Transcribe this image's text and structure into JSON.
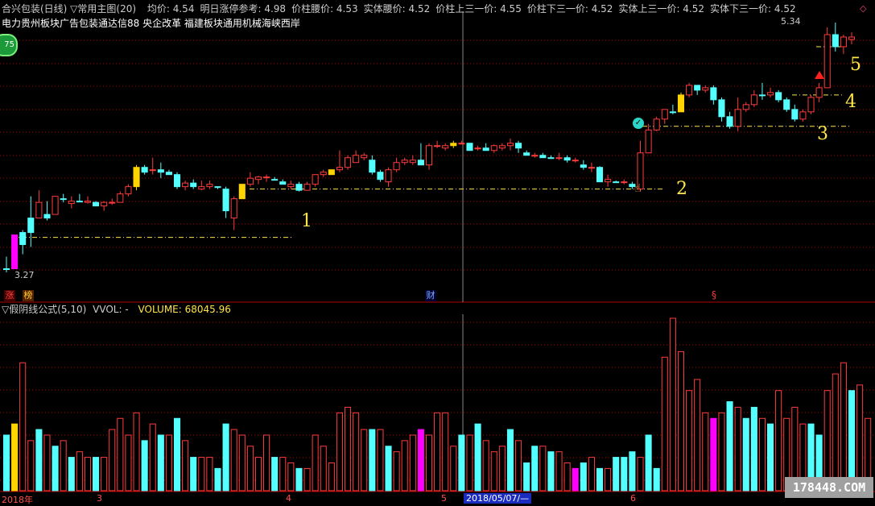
{
  "header": {
    "title": "合兴包装(日线) ▽常用主图(20)",
    "stats": [
      {
        "label": "均价",
        "value": "4.54"
      },
      {
        "label": "明日涨停参考",
        "value": "4.98"
      },
      {
        "label": "价柱腰价",
        "value": "4.53"
      },
      {
        "label": "实体腰价",
        "value": "4.52"
      },
      {
        "label": "价柱上三一价",
        "value": "4.55"
      },
      {
        "label": "价柱下三一价",
        "value": "4.52"
      },
      {
        "label": "实体上三一价",
        "value": "4.52"
      },
      {
        "label": "实体下三一价",
        "value": "4.52"
      }
    ],
    "sectors": "电力贵州板块广告包装通达信88 央企改革 福建板块通用机械海峡西岸",
    "badge": "75"
  },
  "price_labels": {
    "high": "5.34",
    "low": "3.27"
  },
  "markers": {
    "zhang": "涨",
    "bang": "榜",
    "cai": "财",
    "s": "§"
  },
  "annotations": [
    "1",
    "2",
    "3",
    "4",
    "5"
  ],
  "volume_header": {
    "title": "▽假阴线公式(5,10)",
    "vvol": "VVOL: -",
    "volume_label": "VOLUME:",
    "volume_value": "68045.96"
  },
  "x_axis": {
    "labels": [
      "2018年",
      "3",
      "4",
      "5",
      "2018/05/07/—",
      "6"
    ]
  },
  "watermark": "178448.COM",
  "colors": {
    "up": "#ff3c3c",
    "down": "#54ffff",
    "special": "#ff00ff",
    "limit": "#ffd400",
    "grid": "#b00000",
    "text": "#cccccc",
    "mark": "#ffe44a"
  },
  "chart_data": {
    "type": "candlestick",
    "price_range": [
      3.27,
      5.34
    ],
    "candles": [
      [
        3.3,
        3.4,
        3.27,
        3.3,
        "d"
      ],
      [
        3.3,
        3.58,
        3.3,
        3.58,
        "s"
      ],
      [
        3.6,
        3.62,
        3.42,
        3.5,
        "d"
      ],
      [
        3.6,
        3.9,
        3.48,
        3.72,
        "d"
      ],
      [
        3.72,
        3.95,
        3.72,
        3.85,
        "u"
      ],
      [
        3.72,
        3.86,
        3.7,
        3.75,
        "d"
      ],
      [
        3.75,
        3.88,
        3.75,
        3.9,
        "u"
      ],
      [
        3.88,
        3.92,
        3.85,
        3.88,
        "d"
      ],
      [
        3.84,
        3.9,
        3.8,
        3.86,
        "u"
      ],
      [
        3.86,
        3.92,
        3.86,
        3.86,
        "d"
      ],
      [
        3.86,
        3.9,
        3.84,
        3.85,
        "u"
      ],
      [
        3.85,
        3.86,
        3.82,
        3.82,
        "d"
      ],
      [
        3.82,
        3.86,
        3.78,
        3.85,
        "u"
      ],
      [
        3.85,
        3.88,
        3.83,
        3.85,
        "u"
      ],
      [
        3.85,
        3.94,
        3.85,
        3.92,
        "u"
      ],
      [
        3.92,
        4.0,
        3.9,
        3.98,
        "u"
      ],
      [
        3.98,
        4.16,
        3.95,
        4.14,
        "l"
      ],
      [
        4.14,
        4.16,
        4.08,
        4.1,
        "d"
      ],
      [
        4.12,
        4.22,
        4.08,
        4.12,
        "u"
      ],
      [
        4.12,
        4.18,
        4.05,
        4.1,
        "d"
      ],
      [
        4.1,
        4.12,
        4.08,
        4.08,
        "d"
      ],
      [
        4.08,
        4.1,
        3.96,
        3.98,
        "d"
      ],
      [
        3.98,
        4.03,
        3.95,
        4.01,
        "u"
      ],
      [
        4.01,
        4.04,
        3.96,
        3.98,
        "d"
      ],
      [
        3.96,
        4.03,
        3.95,
        3.98,
        "u"
      ],
      [
        3.98,
        4.03,
        3.96,
        4.0,
        "u"
      ],
      [
        3.98,
        3.98,
        3.96,
        3.98,
        "d"
      ],
      [
        3.96,
        3.98,
        3.72,
        3.78,
        "d"
      ],
      [
        3.72,
        3.9,
        3.62,
        3.88,
        "u"
      ],
      [
        3.88,
        4.0,
        3.88,
        4.0,
        "l"
      ],
      [
        4.0,
        4.1,
        3.98,
        4.05,
        "u"
      ],
      [
        4.04,
        4.07,
        4.0,
        4.06,
        "u"
      ],
      [
        4.06,
        4.08,
        4.02,
        4.06,
        "u"
      ],
      [
        4.04,
        4.06,
        4.04,
        4.04,
        "d"
      ],
      [
        4.02,
        4.04,
        4.0,
        4.0,
        "d"
      ],
      [
        3.98,
        4.03,
        3.96,
        4.0,
        "u"
      ],
      [
        4.0,
        4.02,
        3.94,
        3.95,
        "d"
      ],
      [
        3.95,
        4.02,
        3.95,
        4.0,
        "u"
      ],
      [
        4.0,
        4.08,
        3.98,
        4.08,
        "u"
      ],
      [
        4.08,
        4.12,
        4.06,
        4.1,
        "u"
      ],
      [
        4.08,
        4.12,
        4.08,
        4.12,
        "l"
      ],
      [
        4.12,
        4.28,
        4.1,
        4.14,
        "u"
      ],
      [
        4.14,
        4.24,
        4.12,
        4.22,
        "u"
      ],
      [
        4.18,
        4.28,
        4.18,
        4.24,
        "u"
      ],
      [
        4.22,
        4.26,
        4.2,
        4.24,
        "u"
      ],
      [
        4.2,
        4.24,
        4.08,
        4.1,
        "d"
      ],
      [
        4.1,
        4.12,
        4.02,
        4.04,
        "d"
      ],
      [
        4.02,
        4.14,
        3.98,
        4.12,
        "u"
      ],
      [
        4.12,
        4.22,
        4.1,
        4.18,
        "u"
      ],
      [
        4.18,
        4.22,
        4.16,
        4.2,
        "u"
      ],
      [
        4.18,
        4.24,
        4.16,
        4.2,
        "u"
      ],
      [
        4.2,
        4.34,
        4.18,
        4.16,
        "d"
      ],
      [
        4.16,
        4.34,
        4.12,
        4.32,
        "u"
      ],
      [
        4.32,
        4.36,
        4.3,
        4.32,
        "u"
      ],
      [
        4.32,
        4.34,
        4.28,
        4.3,
        "u"
      ],
      [
        4.32,
        4.36,
        4.3,
        4.34,
        "l"
      ],
      [
        4.34,
        4.36,
        4.33,
        4.34,
        "u"
      ],
      [
        4.34,
        4.34,
        4.28,
        4.28,
        "d"
      ],
      [
        4.3,
        4.32,
        4.28,
        4.3,
        "u"
      ],
      [
        4.3,
        4.34,
        4.28,
        4.28,
        "d"
      ],
      [
        4.28,
        4.33,
        4.26,
        4.32,
        "u"
      ],
      [
        4.3,
        4.34,
        4.28,
        4.32,
        "u"
      ],
      [
        4.32,
        4.38,
        4.28,
        4.34,
        "u"
      ],
      [
        4.34,
        4.36,
        4.26,
        4.3,
        "d"
      ],
      [
        4.26,
        4.28,
        4.24,
        4.24,
        "d"
      ],
      [
        4.24,
        4.26,
        4.22,
        4.24,
        "u"
      ],
      [
        4.24,
        4.26,
        4.22,
        4.22,
        "d"
      ],
      [
        4.22,
        4.24,
        4.22,
        4.22,
        "d"
      ],
      [
        4.22,
        4.26,
        4.2,
        4.22,
        "u"
      ],
      [
        4.22,
        4.24,
        4.18,
        4.2,
        "d"
      ],
      [
        4.2,
        4.22,
        4.18,
        4.2,
        "u"
      ],
      [
        4.16,
        4.2,
        4.12,
        4.14,
        "d"
      ],
      [
        4.14,
        4.18,
        4.1,
        4.14,
        "u"
      ],
      [
        4.14,
        4.15,
        4.02,
        4.02,
        "d"
      ],
      [
        4.02,
        4.08,
        3.98,
        4.04,
        "u"
      ],
      [
        4.02,
        4.03,
        4.02,
        4.02,
        "d"
      ],
      [
        4.02,
        4.04,
        4.0,
        4.02,
        "u"
      ],
      [
        4.0,
        4.02,
        3.96,
        3.98,
        "d"
      ],
      [
        3.96,
        4.36,
        3.94,
        4.26,
        "u"
      ],
      [
        4.26,
        4.5,
        4.26,
        4.45,
        "u"
      ],
      [
        4.45,
        4.56,
        4.44,
        4.54,
        "u"
      ],
      [
        4.54,
        4.62,
        4.5,
        4.62,
        "u"
      ],
      [
        4.6,
        4.66,
        4.58,
        4.6,
        "d"
      ],
      [
        4.6,
        4.76,
        4.6,
        4.74,
        "l"
      ],
      [
        4.74,
        4.84,
        4.72,
        4.82,
        "u"
      ],
      [
        4.82,
        4.8,
        4.74,
        4.78,
        "d"
      ],
      [
        4.78,
        4.82,
        4.76,
        4.8,
        "u"
      ],
      [
        4.8,
        4.82,
        4.66,
        4.7,
        "d"
      ],
      [
        4.7,
        4.72,
        4.52,
        4.56,
        "d"
      ],
      [
        4.56,
        4.6,
        4.46,
        4.48,
        "d"
      ],
      [
        4.48,
        4.72,
        4.44,
        4.62,
        "u"
      ],
      [
        4.62,
        4.68,
        4.6,
        4.66,
        "u"
      ],
      [
        4.66,
        4.78,
        4.64,
        4.74,
        "u"
      ],
      [
        4.74,
        4.84,
        4.7,
        4.74,
        "d"
      ],
      [
        4.74,
        4.8,
        4.72,
        4.76,
        "u"
      ],
      [
        4.76,
        4.78,
        4.68,
        4.7,
        "d"
      ],
      [
        4.7,
        4.72,
        4.6,
        4.62,
        "d"
      ],
      [
        4.62,
        4.66,
        4.52,
        4.54,
        "d"
      ],
      [
        4.54,
        4.62,
        4.52,
        4.6,
        "u"
      ],
      [
        4.6,
        4.74,
        4.58,
        4.72,
        "u"
      ],
      [
        4.72,
        4.84,
        4.68,
        4.8,
        "u"
      ],
      [
        4.8,
        5.3,
        4.8,
        5.24,
        "u"
      ],
      [
        5.24,
        5.34,
        5.1,
        5.14,
        "d"
      ],
      [
        5.14,
        5.24,
        5.08,
        5.22,
        "u"
      ],
      [
        5.22,
        5.26,
        5.16,
        5.2,
        "u"
      ]
    ],
    "volumes": [
      [
        10,
        "d"
      ],
      [
        12,
        "l"
      ],
      [
        23,
        "u"
      ],
      [
        9,
        "u"
      ],
      [
        11,
        "d"
      ],
      [
        10,
        "u"
      ],
      [
        8,
        "d"
      ],
      [
        9,
        "u"
      ],
      [
        6,
        "d"
      ],
      [
        7,
        "u"
      ],
      [
        6,
        "u"
      ],
      [
        6,
        "d"
      ],
      [
        6,
        "u"
      ],
      [
        11,
        "u"
      ],
      [
        13,
        "u"
      ],
      [
        10,
        "u"
      ],
      [
        14,
        "u"
      ],
      [
        9,
        "d"
      ],
      [
        12,
        "u"
      ],
      [
        10,
        "d"
      ],
      [
        10,
        "u"
      ],
      [
        13,
        "d"
      ],
      [
        9,
        "u"
      ],
      [
        6,
        "d"
      ],
      [
        6,
        "u"
      ],
      [
        6,
        "u"
      ],
      [
        4,
        "d"
      ],
      [
        12,
        "d"
      ],
      [
        11,
        "u"
      ],
      [
        10,
        "u"
      ],
      [
        8,
        "u"
      ],
      [
        6,
        "u"
      ],
      [
        10,
        "u"
      ],
      [
        6,
        "d"
      ],
      [
        6,
        "u"
      ],
      [
        5,
        "u"
      ],
      [
        4,
        "d"
      ],
      [
        4,
        "u"
      ],
      [
        10,
        "u"
      ],
      [
        8,
        "u"
      ],
      [
        5,
        "u"
      ],
      [
        14,
        "u"
      ],
      [
        15,
        "u"
      ],
      [
        14,
        "u"
      ],
      [
        11,
        "u"
      ],
      [
        11,
        "d"
      ],
      [
        11,
        "u"
      ],
      [
        8,
        "d"
      ],
      [
        7,
        "u"
      ],
      [
        9,
        "u"
      ],
      [
        10,
        "u"
      ],
      [
        11,
        "s"
      ],
      [
        10,
        "u"
      ],
      [
        14,
        "u"
      ],
      [
        14,
        "u"
      ],
      [
        8,
        "u"
      ],
      [
        10,
        "d"
      ],
      [
        10,
        "u"
      ],
      [
        12,
        "d"
      ],
      [
        9,
        "u"
      ],
      [
        7,
        "u"
      ],
      [
        8,
        "u"
      ],
      [
        11,
        "d"
      ],
      [
        9,
        "u"
      ],
      [
        5,
        "d"
      ],
      [
        8,
        "d"
      ],
      [
        8,
        "u"
      ],
      [
        7,
        "d"
      ],
      [
        7,
        "u"
      ],
      [
        5,
        "u"
      ],
      [
        4,
        "s"
      ],
      [
        5,
        "d"
      ],
      [
        6,
        "u"
      ],
      [
        4,
        "d"
      ],
      [
        4,
        "u"
      ],
      [
        6,
        "d"
      ],
      [
        6,
        "d"
      ],
      [
        7,
        "d"
      ],
      [
        6,
        "u"
      ],
      [
        10,
        "d"
      ],
      [
        4,
        "d"
      ],
      [
        24,
        "u"
      ],
      [
        31,
        "u"
      ],
      [
        25,
        "u"
      ],
      [
        18,
        "u"
      ],
      [
        20,
        "u"
      ],
      [
        14,
        "u"
      ],
      [
        13,
        "s"
      ],
      [
        14,
        "u"
      ],
      [
        16,
        "d"
      ],
      [
        15,
        "u"
      ],
      [
        13,
        "d"
      ],
      [
        15,
        "d"
      ],
      [
        13,
        "u"
      ],
      [
        12,
        "d"
      ],
      [
        18,
        "u"
      ],
      [
        13,
        "u"
      ],
      [
        15,
        "u"
      ],
      [
        12,
        "u"
      ],
      [
        12,
        "d"
      ],
      [
        10,
        "d"
      ],
      [
        18,
        "u"
      ],
      [
        21,
        "u"
      ],
      [
        23,
        "u"
      ],
      [
        18,
        "d"
      ],
      [
        19,
        "u"
      ],
      [
        13,
        "u"
      ]
    ]
  }
}
